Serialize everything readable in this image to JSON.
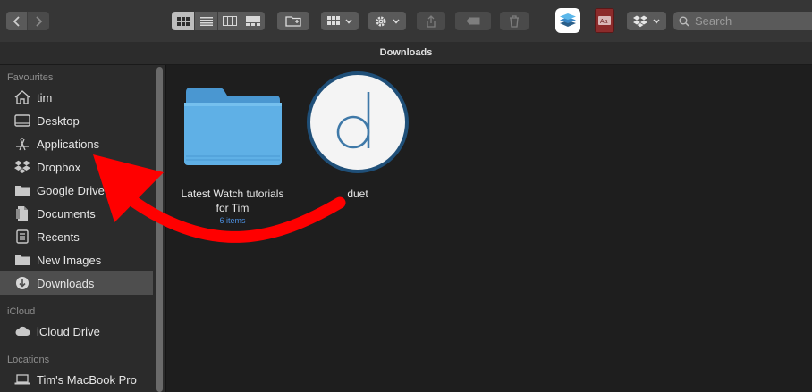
{
  "window": {
    "title": "Downloads"
  },
  "toolbar": {
    "search_placeholder": "Search"
  },
  "sidebar": {
    "sections": [
      {
        "header": "Favourites",
        "items": [
          {
            "label": "tim",
            "icon": "house-icon"
          },
          {
            "label": "Desktop",
            "icon": "desktop-icon"
          },
          {
            "label": "Applications",
            "icon": "applications-icon"
          },
          {
            "label": "Dropbox",
            "icon": "dropbox-icon"
          },
          {
            "label": "Google Drive",
            "icon": "folder-icon"
          },
          {
            "label": "Documents",
            "icon": "document-icon"
          },
          {
            "label": "Recents",
            "icon": "recents-icon"
          },
          {
            "label": "New Images",
            "icon": "folder-icon"
          },
          {
            "label": "Downloads",
            "icon": "downloads-icon",
            "selected": true
          }
        ]
      },
      {
        "header": "iCloud",
        "items": [
          {
            "label": "iCloud Drive",
            "icon": "cloud-icon"
          }
        ]
      },
      {
        "header": "Locations",
        "items": [
          {
            "label": "Tim's MacBook Pro",
            "icon": "laptop-icon"
          }
        ]
      }
    ]
  },
  "files": [
    {
      "name": "Latest Watch tutorials for Tim",
      "name_line1": "Latest Watch tutorials",
      "name_line2": "for Tim",
      "subtitle": "6 items",
      "icon": "folder-icon"
    },
    {
      "name": "duet",
      "icon": "duet-app-icon"
    }
  ],
  "annotation": {
    "type": "red-arrow",
    "color": "#ff0000",
    "points_to": "Applications"
  },
  "colors": {
    "accent_blue": "#4b8fe0",
    "folder_blue": "#5fb0e6",
    "arrow_red": "#ff0000"
  }
}
